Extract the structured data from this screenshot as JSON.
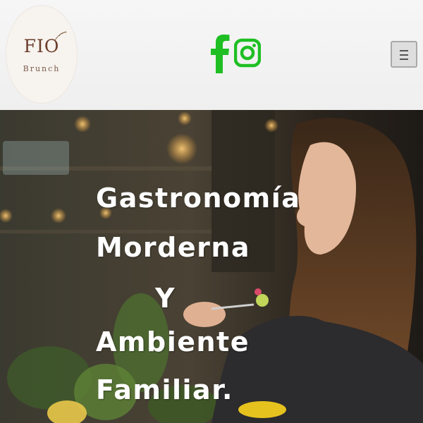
{
  "logo": {
    "name": "FIO",
    "sub": "Brunch"
  },
  "social": {
    "facebook_icon": "facebook-icon",
    "instagram_icon": "instagram-icon",
    "color": "#1fbf24"
  },
  "menu": {
    "icon": "hamburger-icon"
  },
  "hero": {
    "image": "woman-eating-in-restaurant-photo",
    "heading_lines": [
      "Gastronomía",
      "Morderna",
      "Y",
      "Ambiente",
      "Familiar."
    ]
  }
}
